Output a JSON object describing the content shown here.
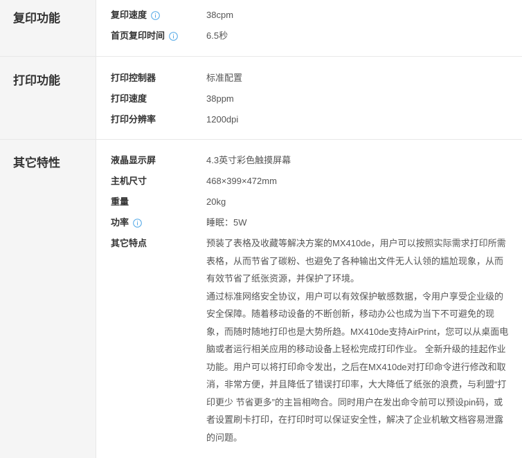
{
  "sections": [
    {
      "title": "复印功能",
      "rows": [
        {
          "label": "复印速度",
          "value": "38cpm",
          "info_icon": "info-circle-icon"
        },
        {
          "label": "首页复印时间",
          "value": "6.5秒",
          "info_icon": "info-circle-icon"
        }
      ]
    },
    {
      "title": "打印功能",
      "rows": [
        {
          "label": "打印控制器",
          "value": "标准配置"
        },
        {
          "label": "打印速度",
          "value": "38ppm"
        },
        {
          "label": "打印分辨率",
          "value": "1200dpi"
        }
      ]
    },
    {
      "title": "其它特性",
      "rows": [
        {
          "label": "液晶显示屏",
          "value": "4.3英寸彩色触摸屏幕"
        },
        {
          "label": "主机尺寸",
          "value": "468×399×472mm"
        },
        {
          "label": "重量",
          "value": "20kg"
        },
        {
          "label": "功率",
          "value": "睡眠：5W",
          "info_icon": "info-circle-icon"
        },
        {
          "label": "其它特点",
          "paragraphs": [
            "预装了表格及收藏等解决方案的MX410de，用户可以按照实际需求打印所需表格，从而节省了碳粉、也避免了各种输出文件无人认领的尴尬现象，从而有效节省了纸张资源，并保护了环境。",
            "通过标准网络安全协议，用户可以有效保护敏感数据，令用户享受企业级的安全保障。随着移动设备的不断创新，移动办公也成为当下不可避免的现象，而随时随地打印也是大势所趋。MX410de支持AirPrint，您可以从桌面电脑或者运行相关应用的移动设备上轻松完成打印作业。 全新升级的挂起作业功能。用户可以将打印命令发出，之后在MX410de对打印命令进行修改和取消，非常方便，并且降低了错误打印率，大大降低了纸张的浪费，与利盟“打印更少 节省更多”的主旨相吻合。同时用户在发出命令前可以预设pin码，或者设置刷卡打印，在打印时可以保证安全性，解决了企业机敏文档容易泄露的问题。"
          ]
        }
      ]
    }
  ],
  "colors": {
    "title_bg": "#f5f5f5",
    "border": "#e8e8e8",
    "info_icon": "#4ea6e6",
    "label_text": "#333333",
    "value_text": "#555555"
  }
}
